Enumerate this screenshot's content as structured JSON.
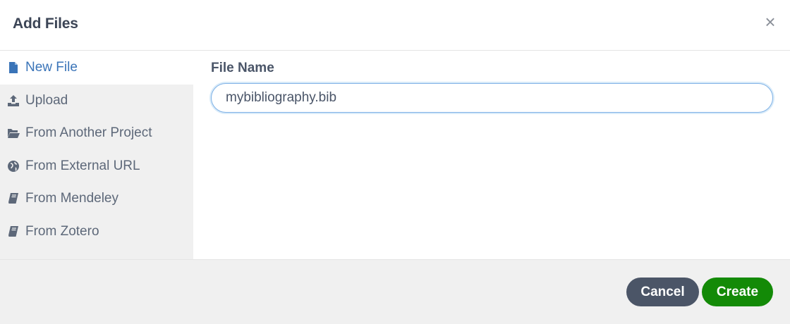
{
  "dialog": {
    "title": "Add Files",
    "close_label": "×"
  },
  "sidebar": {
    "items": [
      {
        "label": "New File",
        "icon": "file-icon",
        "active": true
      },
      {
        "label": "Upload",
        "icon": "upload-icon",
        "active": false
      },
      {
        "label": "From Another Project",
        "icon": "folder-open-icon",
        "active": false
      },
      {
        "label": "From External URL",
        "icon": "globe-icon",
        "active": false
      },
      {
        "label": "From Mendeley",
        "icon": "book-icon",
        "active": false
      },
      {
        "label": "From Zotero",
        "icon": "book-icon",
        "active": false
      }
    ]
  },
  "form": {
    "file_name_label": "File Name",
    "file_name_value": "mybibliography.bib"
  },
  "footer": {
    "cancel_label": "Cancel",
    "create_label": "Create"
  },
  "colors": {
    "active_link": "#3a74b8",
    "create_button": "#138a07",
    "cancel_button": "#4b5567",
    "sidebar_bg": "#f0f0f0"
  }
}
